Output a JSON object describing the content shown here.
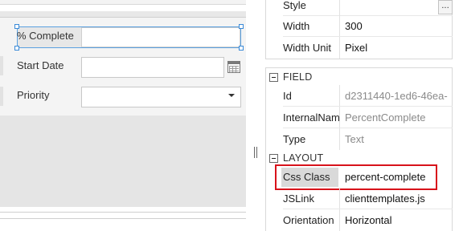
{
  "form": {
    "fields": [
      {
        "label": "% Complete",
        "value": ""
      },
      {
        "label": "Start Date",
        "value": ""
      },
      {
        "label": "Priority",
        "value": ""
      }
    ]
  },
  "properties": {
    "general": [
      {
        "name": "Style",
        "value": ""
      },
      {
        "name": "Width",
        "value": "300"
      },
      {
        "name": "Width Unit",
        "value": "Pixel"
      }
    ],
    "ellipsis_label": "...",
    "field_category": "FIELD",
    "field": [
      {
        "name": "Id",
        "value": "d2311440-1ed6-46ea-"
      },
      {
        "name": "InternalNam",
        "value": "PercentComplete"
      },
      {
        "name": "Type",
        "value": "Text"
      }
    ],
    "layout_category": "LAYOUT",
    "layout": [
      {
        "name": "Css Class",
        "value": "percent-complete"
      },
      {
        "name": "JSLink",
        "value": "clienttemplates.js"
      },
      {
        "name": "Orientation",
        "value": "Horizontal"
      }
    ]
  },
  "colors": {
    "selection": "#5aa0e0",
    "highlight": "#d8121b"
  }
}
